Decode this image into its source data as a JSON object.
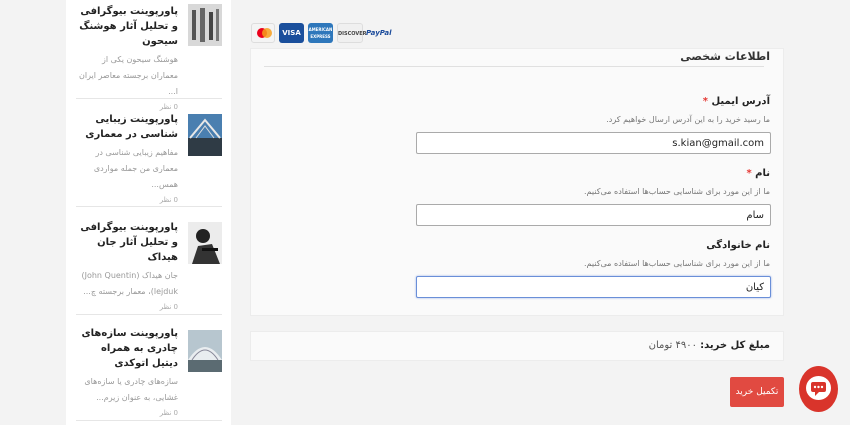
{
  "sidebar": {
    "posts": [
      {
        "title": "پاورپوینت بیوگرافی و تحلیل آثار هوشنگ سیحون",
        "excerpt": "هوشنگ سیحون یکی از معماران برجسته معاصر ایران ا...",
        "comments": "0 نظر"
      },
      {
        "title": "پاورپوینت زیبایی شناسی در معماری",
        "excerpt": "مفاهیم زیبایی شناسی در معماری من جمله مواردی همس...",
        "comments": "0 نظر"
      },
      {
        "title": "پاورپوینت بیوگرافی و تحلیل آثار جان هیداک",
        "excerpt": "جان هیداک (John Quentin) lejduk)، معمار برجسته چ...",
        "comments": "0 نظر"
      },
      {
        "title": "پاورپوینت سازه‌های چادری به همراه دیتیل اتوکدی",
        "excerpt": "سازه‌های چادری یا سازه‌های غشایی، به عنوان زیرم...",
        "comments": "0 نظر"
      }
    ]
  },
  "payment_icons": [
    {
      "name": "mastercard-icon",
      "label": "mastercard",
      "color": "#f4f4f4"
    },
    {
      "name": "visa-icon",
      "label": "VISA",
      "color": "#1a4f9c"
    },
    {
      "name": "amex-icon",
      "label": "AMERICAN EXPRESS",
      "color": "#2e77bb"
    },
    {
      "name": "discover-icon",
      "label": "DISCOVER",
      "color": "#f0f0f0"
    },
    {
      "name": "paypal-icon",
      "label": "PayPal",
      "color": "#ffffff"
    }
  ],
  "form": {
    "section_title": "اطلاعات شخصی",
    "email": {
      "label": "آدرس ایمیل",
      "required_mark": "*",
      "help": "ما رسید خرید را به این آدرس ارسال خواهیم کرد.",
      "value": "s.kian@gmail.com"
    },
    "first_name": {
      "label": "نام",
      "required_mark": "*",
      "help": "ما از این مورد برای شناسایی حساب‌ها استفاده می‌کنیم.",
      "value": "سام"
    },
    "last_name": {
      "label": "نام خانوادگی",
      "help": "ما از این مورد برای شناسایی حساب‌ها استفاده می‌کنیم.",
      "value": "کیان"
    }
  },
  "total": {
    "label": "مبلغ کل خرید:",
    "amount": "۴۹۰۰ تومان"
  },
  "submit_label": "تکمیل خرید",
  "colors": {
    "accent": "#e14a41",
    "focus": "#6a8fd8"
  }
}
